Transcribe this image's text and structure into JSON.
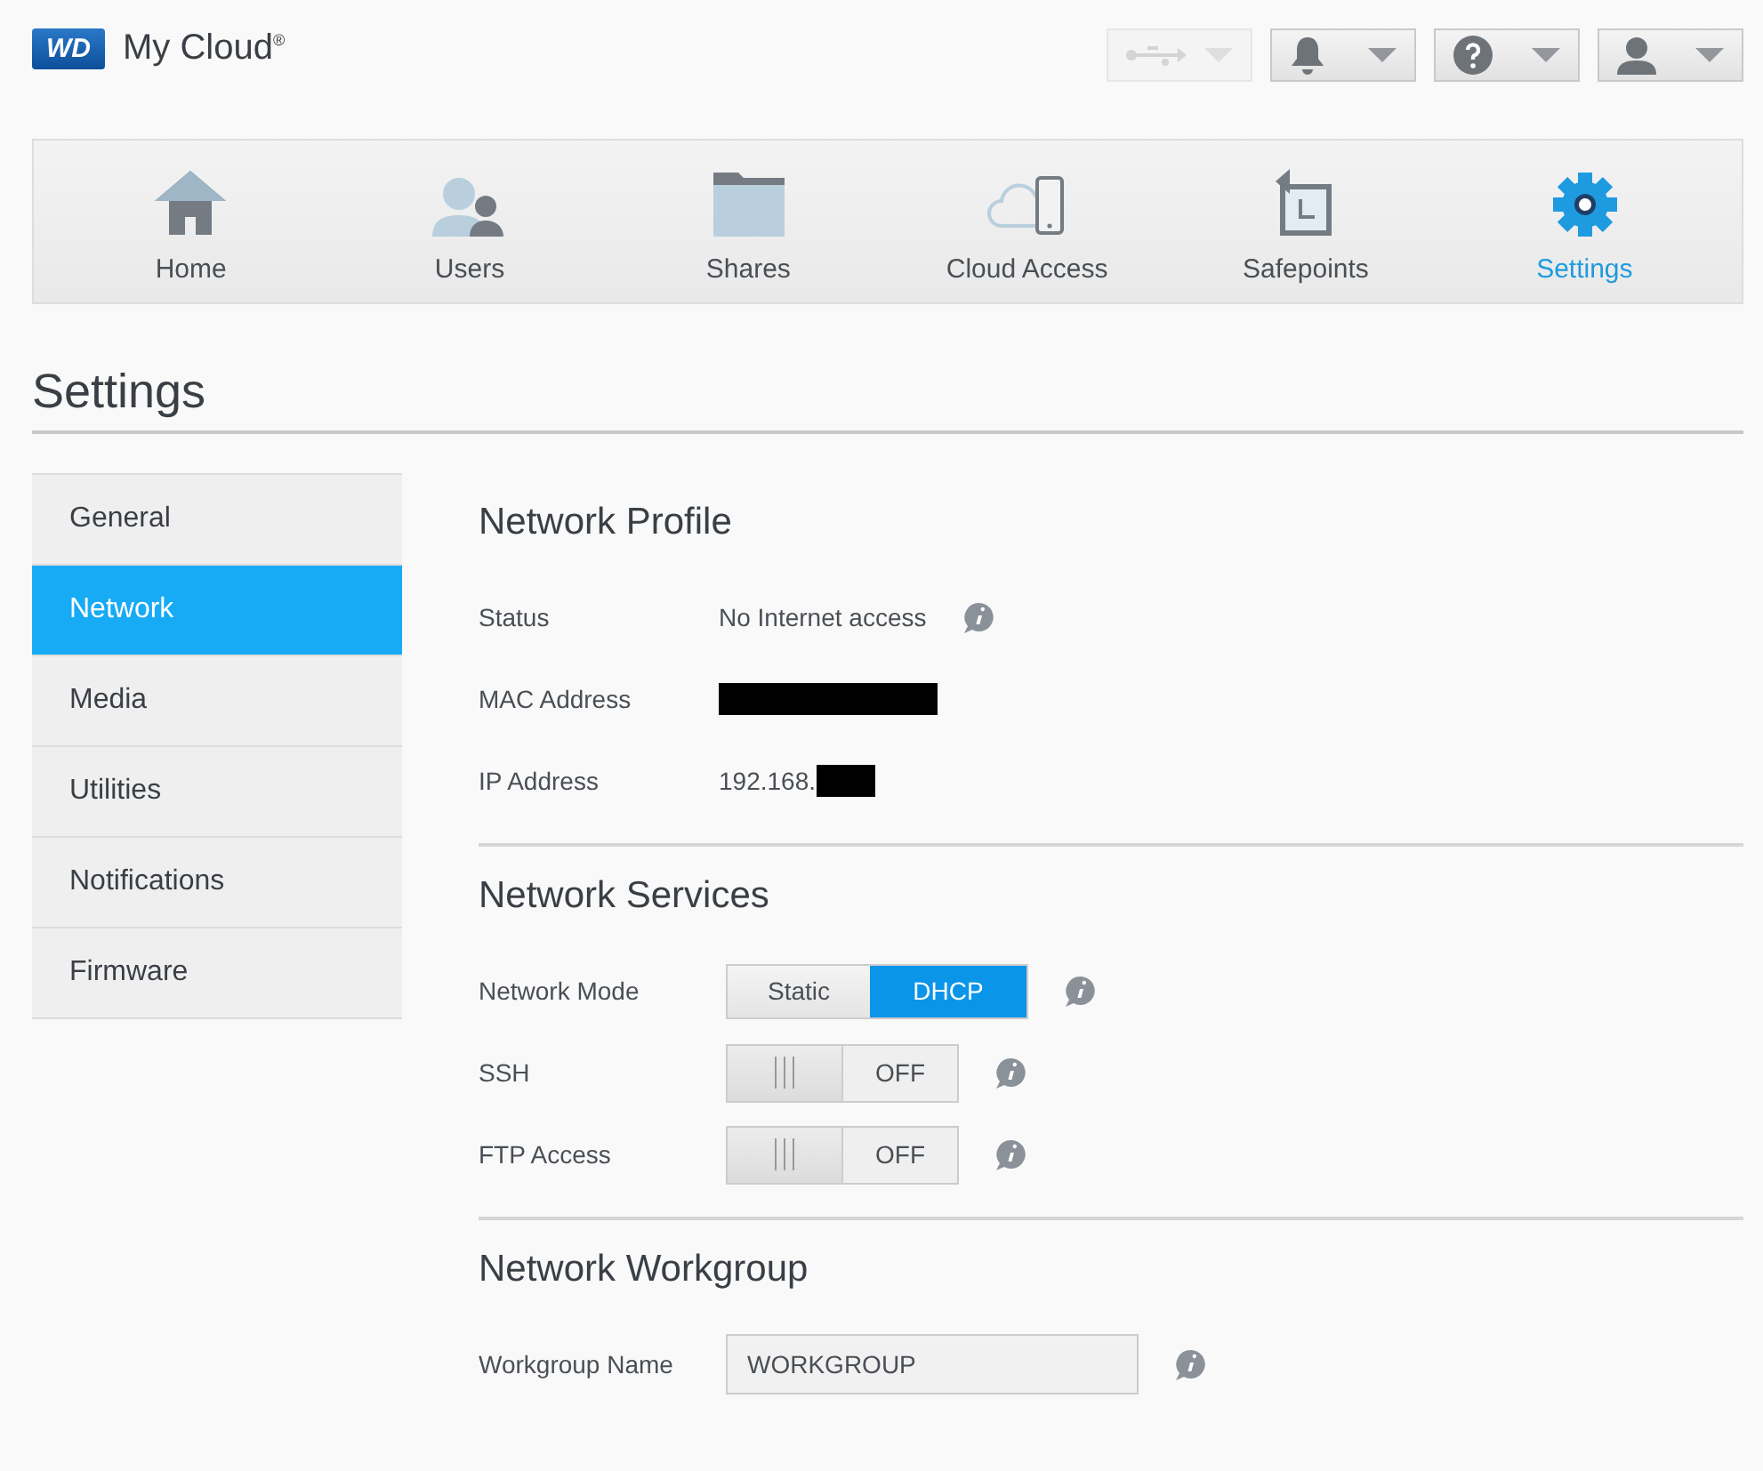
{
  "brand": {
    "logo": "WD",
    "name": "My Cloud",
    "mark": "®"
  },
  "header_buttons": [
    {
      "kind": "usb",
      "disabled": true
    },
    {
      "kind": "bell",
      "disabled": false
    },
    {
      "kind": "help",
      "disabled": false
    },
    {
      "kind": "user",
      "disabled": false
    }
  ],
  "nav": [
    {
      "kind": "home",
      "label": "Home",
      "selected": false
    },
    {
      "kind": "users",
      "label": "Users",
      "selected": false
    },
    {
      "kind": "shares",
      "label": "Shares",
      "selected": false
    },
    {
      "kind": "cloud",
      "label": "Cloud Access",
      "selected": false
    },
    {
      "kind": "safepoints",
      "label": "Safepoints",
      "selected": false
    },
    {
      "kind": "settings",
      "label": "Settings",
      "selected": true
    }
  ],
  "page_title": "Settings",
  "sidebar": [
    {
      "label": "General",
      "selected": false
    },
    {
      "label": "Network",
      "selected": true
    },
    {
      "label": "Media",
      "selected": false
    },
    {
      "label": "Utilities",
      "selected": false
    },
    {
      "label": "Notifications",
      "selected": false
    },
    {
      "label": "Firmware",
      "selected": false
    }
  ],
  "sections": [
    {
      "title": "Network Profile",
      "rows": [
        {
          "kind": "text",
          "label": "Status",
          "value": "No Internet access",
          "info": true
        },
        {
          "kind": "text",
          "label": "MAC Address",
          "redacted": true
        },
        {
          "kind": "text",
          "label": "IP Address",
          "value": "192.168.",
          "redacted": true
        }
      ]
    },
    {
      "title": "Network Services",
      "rows": [
        {
          "kind": "segmented",
          "label": "Network Mode",
          "options": [
            {
              "label": "Static",
              "selected": false
            },
            {
              "label": "DHCP",
              "selected": true
            }
          ],
          "info": true
        },
        {
          "kind": "toggle",
          "label": "SSH",
          "state": "OFF",
          "on": false,
          "info": true
        },
        {
          "kind": "toggle",
          "label": "FTP Access",
          "state": "OFF",
          "on": false,
          "info": true
        }
      ]
    },
    {
      "title": "Network Workgroup",
      "rows": [
        {
          "kind": "input",
          "label": "Workgroup Name",
          "value": "WORKGROUP",
          "info": true
        }
      ]
    }
  ]
}
